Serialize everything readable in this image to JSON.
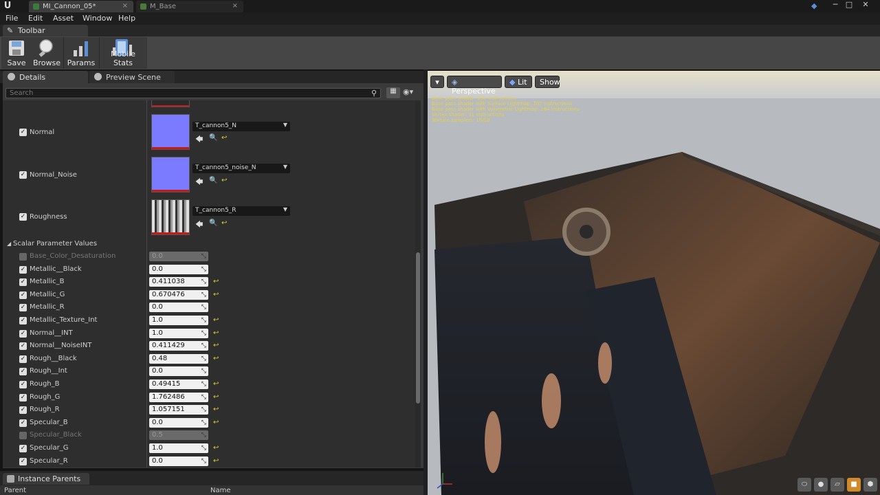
{
  "tabs": [
    {
      "label": "MI_Cannon_05*"
    },
    {
      "label": "M_Base"
    }
  ],
  "menu": [
    "File",
    "Edit",
    "Asset",
    "Window",
    "Help"
  ],
  "toolbar_panel": {
    "tab": "Toolbar"
  },
  "toolbar": {
    "save": "Save",
    "browse": "Browse",
    "params": "Params",
    "mobile_stats": "Mobile Stats"
  },
  "panel_tabs": {
    "details": "Details",
    "preview": "Preview Scene Set"
  },
  "search": {
    "placeholder": "Search"
  },
  "textures": [
    {
      "label": "Normal",
      "value": "T_cannon5_N"
    },
    {
      "label": "Normal_Noise",
      "value": "T_cannon5_noise_N"
    },
    {
      "label": "Roughness",
      "value": "T_cannon5_R"
    }
  ],
  "scalar_section": "Scalar Parameter Values",
  "scalars": [
    {
      "label": "Base_Color_Desaturation",
      "value": "0.0",
      "enabled": false,
      "reset": false
    },
    {
      "label": "Metallic__Black",
      "value": "0.0",
      "enabled": true,
      "reset": false
    },
    {
      "label": "Metallic_B",
      "value": "0.411038",
      "enabled": true,
      "reset": true
    },
    {
      "label": "Metallic_G",
      "value": "0.670476",
      "enabled": true,
      "reset": true
    },
    {
      "label": "Metallic_R",
      "value": "0.0",
      "enabled": true,
      "reset": false
    },
    {
      "label": "Metallic_Texture_Int",
      "value": "1.0",
      "enabled": true,
      "reset": true
    },
    {
      "label": "Normal__INT",
      "value": "1.0",
      "enabled": true,
      "reset": true
    },
    {
      "label": "Normal__NoiseINT",
      "value": "0.411429",
      "enabled": true,
      "reset": true
    },
    {
      "label": "Rough__Black",
      "value": "0.48",
      "enabled": true,
      "reset": true
    },
    {
      "label": "Rough__Int",
      "value": "0.0",
      "enabled": true,
      "reset": false
    },
    {
      "label": "Rough_B",
      "value": "0.49415",
      "enabled": true,
      "reset": true
    },
    {
      "label": "Rough_G",
      "value": "1.762486",
      "enabled": true,
      "reset": true
    },
    {
      "label": "Rough_R",
      "value": "1.057151",
      "enabled": true,
      "reset": true
    },
    {
      "label": "Specular_B",
      "value": "0.0",
      "enabled": true,
      "reset": true
    },
    {
      "label": "Specular_Black",
      "value": "0.5",
      "enabled": false,
      "reset": false
    },
    {
      "label": "Specular_G",
      "value": "1.0",
      "enabled": true,
      "reset": true
    },
    {
      "label": "Specular_R",
      "value": "0.0",
      "enabled": true,
      "reset": true
    }
  ],
  "instance_parents": {
    "tab": "Instance Parents",
    "col_parent": "Parent",
    "col_name": "Name"
  },
  "viewport": {
    "perspective": "Perspective",
    "lit": "Lit",
    "show": "Show",
    "stats": [
      "Base pass shader: 190 instructions",
      "Base pass shader with Surface Lightmap: 207 instructions",
      "Base pass shader with Volumetric Lightmap: 264 instructions",
      "Vertex shader: 31 instructions",
      "Texture samplers: 10/16"
    ]
  },
  "colors": {
    "accent": "#e8c832",
    "checkbox": "#e0e0e0",
    "active_nav": "#d08a2a"
  }
}
